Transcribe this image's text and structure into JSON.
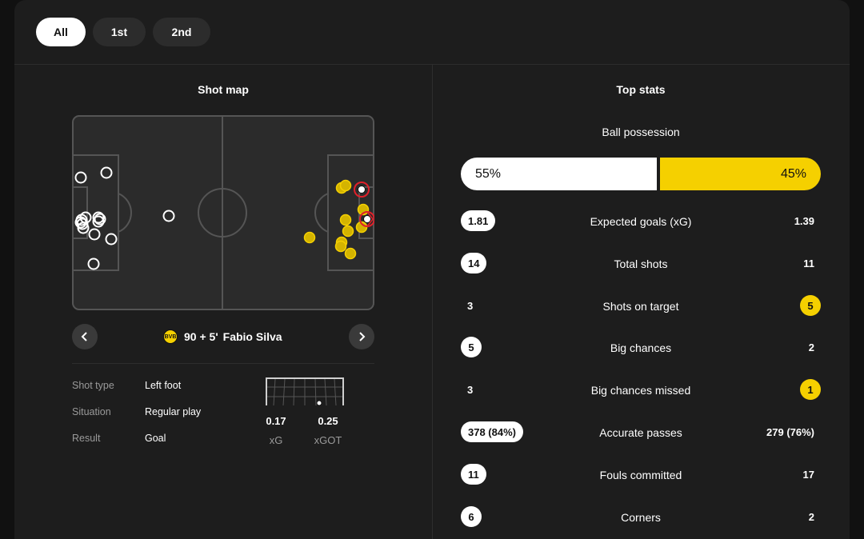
{
  "tabs": [
    {
      "label": "All",
      "active": true
    },
    {
      "label": "1st",
      "active": false
    },
    {
      "label": "2nd",
      "active": false
    }
  ],
  "shot_map": {
    "title": "Shot map",
    "selected_shot": {
      "time": "90 + 5'",
      "player": "Fabio Silva",
      "team_crest_icon": "bvb-crest-icon"
    },
    "details": [
      {
        "key": "Shot type",
        "value": "Left foot"
      },
      {
        "key": "Situation",
        "value": "Regular play"
      },
      {
        "key": "Result",
        "value": "Goal"
      }
    ],
    "xg": {
      "value": "0.17",
      "label": "xG"
    },
    "xgot": {
      "value": "0.25",
      "label": "xGOT"
    },
    "colors": {
      "home": "#ffffff",
      "away": "#f5d000",
      "highlight": "#e0202a",
      "pitch": "#2b2b2b",
      "lines": "#555555"
    }
  },
  "top_stats": {
    "title": "Top stats",
    "possession": {
      "label": "Ball possession",
      "home": "55%",
      "away": "45%",
      "home_pct": 55,
      "away_pct": 45
    },
    "rows": [
      {
        "label": "Expected goals (xG)",
        "home": "1.81",
        "away": "1.39",
        "highlight": "home"
      },
      {
        "label": "Total shots",
        "home": "14",
        "away": "11",
        "highlight": "home"
      },
      {
        "label": "Shots on target",
        "home": "3",
        "away": "5",
        "highlight": "away"
      },
      {
        "label": "Big chances",
        "home": "5",
        "away": "2",
        "highlight": "home"
      },
      {
        "label": "Big chances missed",
        "home": "3",
        "away": "1",
        "highlight": "away"
      },
      {
        "label": "Accurate passes",
        "home": "378 (84%)",
        "away": "279 (76%)",
        "highlight": "home"
      },
      {
        "label": "Fouls committed",
        "home": "11",
        "away": "17",
        "highlight": "home"
      },
      {
        "label": "Corners",
        "home": "6",
        "away": "2",
        "highlight": "home"
      }
    ]
  }
}
